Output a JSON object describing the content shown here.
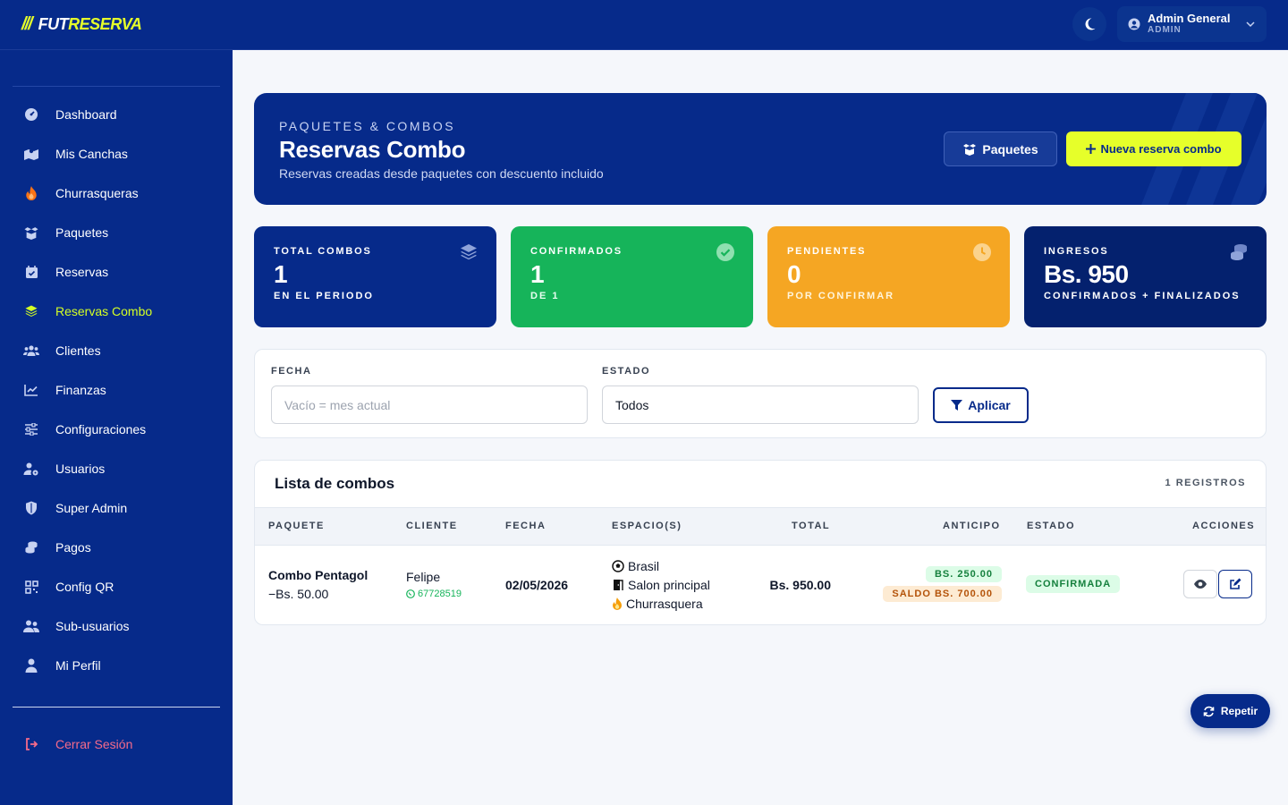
{
  "app": {
    "logo_slashes": "///",
    "logo_main": "FUT",
    "logo_accent": "RESERVA"
  },
  "header": {
    "user_name": "Admin General",
    "user_role": "ADMIN"
  },
  "sidebar": {
    "items": [
      {
        "label": "Dashboard",
        "icon": "gauge-icon"
      },
      {
        "label": "Mis Canchas",
        "icon": "map-icon"
      },
      {
        "label": "Churrasqueras",
        "icon": "fire-icon"
      },
      {
        "label": "Paquetes",
        "icon": "box-open-icon"
      },
      {
        "label": "Reservas",
        "icon": "calendar-check-icon"
      },
      {
        "label": "Reservas Combo",
        "icon": "layers-icon",
        "active": true
      },
      {
        "label": "Clientes",
        "icon": "users-icon"
      },
      {
        "label": "Finanzas",
        "icon": "chart-line-icon"
      },
      {
        "label": "Configuraciones",
        "icon": "sliders-icon"
      },
      {
        "label": "Usuarios",
        "icon": "user-gear-icon"
      },
      {
        "label": "Super Admin",
        "icon": "shield-icon"
      },
      {
        "label": "Pagos",
        "icon": "coins-icon"
      },
      {
        "label": "Config QR",
        "icon": "qrcode-icon"
      },
      {
        "label": "Sub-usuarios",
        "icon": "user-group-icon"
      },
      {
        "label": "Mi Perfil",
        "icon": "user-icon"
      }
    ],
    "logout": "Cerrar Sesión"
  },
  "hero": {
    "kicker": "PAQUETES & COMBOS",
    "title": "Reservas Combo",
    "subtitle": "Reservas creadas desde paquetes con descuento incluido",
    "btn_paquetes": "Paquetes",
    "btn_nueva": "Nueva reserva combo"
  },
  "stats": [
    {
      "label": "TOTAL COMBOS",
      "value": "1",
      "sub": "EN EL PERIODO",
      "icon": "layers-icon"
    },
    {
      "label": "CONFIRMADOS",
      "value": "1",
      "sub": "DE 1",
      "icon": "check-circle-icon"
    },
    {
      "label": "PENDIENTES",
      "value": "0",
      "sub": "POR CONFIRMAR",
      "icon": "clock-icon"
    },
    {
      "label": "INGRESOS",
      "value": "Bs. 950",
      "sub": "CONFIRMADOS + FINALIZADOS",
      "icon": "coins-icon"
    }
  ],
  "filters": {
    "fecha_label": "FECHA",
    "fecha_placeholder": "Vacío = mes actual",
    "estado_label": "ESTADO",
    "estado_value": "Todos",
    "apply": "Aplicar"
  },
  "list": {
    "title": "Lista de combos",
    "count": "1 REGISTROS",
    "columns": [
      "PAQUETE",
      "CLIENTE",
      "FECHA",
      "ESPACIO(S)",
      "TOTAL",
      "ANTICIPO",
      "ESTADO",
      "ACCIONES"
    ],
    "rows": [
      {
        "paquete": "Combo Pentagol",
        "descuento": "−Bs. 50.00",
        "cliente": "Felipe",
        "telefono": "67728519",
        "fecha": "02/05/2026",
        "espacios": [
          "Brasil",
          "Salon principal",
          "Churrasquera"
        ],
        "total": "Bs. 950.00",
        "anticipo": "BS. 250.00",
        "saldo": "SALDO BS. 700.00",
        "estado": "CONFIRMADA"
      }
    ]
  },
  "fab": {
    "label": "Repetir"
  },
  "colors": {
    "primary": "#062a8a",
    "accent": "#e6ff2a",
    "success": "#16b45a",
    "warning": "#f5a623",
    "dark": "#04216e"
  }
}
